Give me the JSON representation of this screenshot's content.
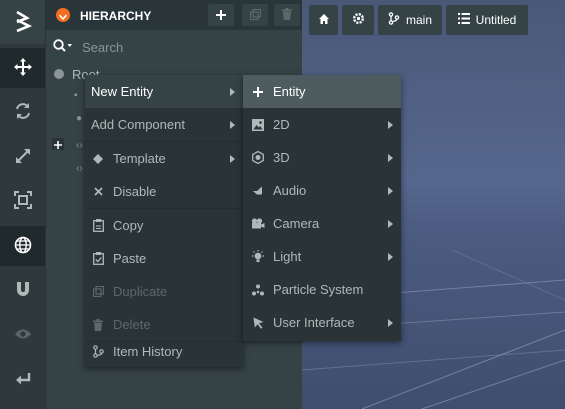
{
  "hierarchy": {
    "title": "HIERARCHY",
    "search_placeholder": "Search",
    "root_label": "Root"
  },
  "viewport_toolbar": {
    "home_icon": "home-icon",
    "settings_icon": "gear-icon",
    "branch_label": "main",
    "scene_label": "Untitled"
  },
  "left_toolbar": {
    "tools": [
      "logo-icon",
      "move-icon",
      "rotate-icon",
      "scale-icon",
      "resize-icon",
      "world-icon",
      "magnet-icon",
      "eye-icon",
      "undo-icon"
    ]
  },
  "context_menu": {
    "items": [
      {
        "label": "New Entity",
        "icon": "",
        "submenu": true,
        "state": "hover"
      },
      {
        "label": "Add Component",
        "icon": "",
        "submenu": true,
        "state": "normal"
      },
      {
        "label": "Template",
        "icon": "diamond-icon",
        "submenu": true,
        "state": "normal"
      },
      {
        "label": "Disable",
        "icon": "x-icon",
        "submenu": false,
        "state": "normal"
      },
      {
        "label": "Copy",
        "icon": "clipboard-icon",
        "submenu": false,
        "state": "normal"
      },
      {
        "label": "Paste",
        "icon": "clipboard-check-icon",
        "submenu": false,
        "state": "normal"
      },
      {
        "label": "Duplicate",
        "icon": "duplicate-icon",
        "submenu": false,
        "state": "disabled"
      },
      {
        "label": "Delete",
        "icon": "trash-icon",
        "submenu": false,
        "state": "disabled"
      },
      {
        "label": "Item History",
        "icon": "history-icon",
        "submenu": false,
        "state": "normal"
      }
    ]
  },
  "submenu": {
    "items": [
      {
        "label": "Entity",
        "icon": "plus-icon",
        "submenu": false
      },
      {
        "label": "2D",
        "icon": "image-icon",
        "submenu": true
      },
      {
        "label": "3D",
        "icon": "hexagon-icon",
        "submenu": true
      },
      {
        "label": "Audio",
        "icon": "speaker-icon",
        "submenu": true
      },
      {
        "label": "Camera",
        "icon": "camera-icon",
        "submenu": true
      },
      {
        "label": "Light",
        "icon": "bulb-icon",
        "submenu": true
      },
      {
        "label": "Particle System",
        "icon": "particles-icon",
        "submenu": false
      },
      {
        "label": "User Interface",
        "icon": "cursor-icon",
        "submenu": true
      }
    ]
  },
  "colors": {
    "accent": "#f26e20",
    "panel": "#364346",
    "menu_bg": "#2a3336",
    "highlight": "#4f5c5f"
  }
}
